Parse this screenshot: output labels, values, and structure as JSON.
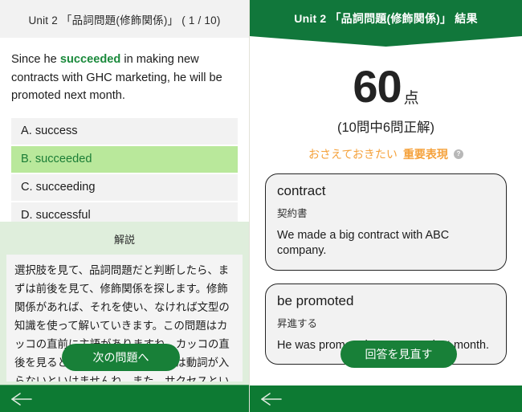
{
  "left_panel": {
    "header_title": "Unit 2 「品詞問題(修飾関係)」 ( 1 / 10)",
    "question_text_before": "Since he ",
    "question_highlight": "succeeded",
    "question_text_after": " in making new contracts with GHC marketing, he will be promoted next month.",
    "choices": [
      {
        "label": "A. success",
        "selected": false
      },
      {
        "label": "B. succeeded",
        "selected": true
      },
      {
        "label": "C. succeeding",
        "selected": false
      },
      {
        "label": "D. successful",
        "selected": false
      }
    ],
    "explanation_title": "解説",
    "explanation_body": "選択肢を見て、品詞問題だと判断したら、まずは前後を見て、修飾関係を探します。修飾関係があれば、それを使い、なければ文型の知識を使って解いていきます。この問題はカッコの直前に主語がありますね。カッコの直後を見ると動詞があり、カッコには動詞が入らないといけませんね。また、サクセスという言葉はカタカナでも使いますが、これは",
    "next_button_label": "次の問題へ",
    "back_icon": "back-arrow-icon"
  },
  "right_panel": {
    "header_title": "Unit 2 「品詞問題(修飾関係)」 結果",
    "score_number": "60",
    "score_unit": "点",
    "score_detail": "(10問中6問正解)",
    "key_expressions_label_1": "おさえておきたい",
    "key_expressions_label_2": "重要表現",
    "help_icon_glyph": "?",
    "cards": [
      {
        "term": "contract",
        "japanese": "契約書",
        "example": "We made a big contract with ABC company."
      },
      {
        "term": "be promoted",
        "japanese": "昇進する",
        "example": "He was promoted to manager last month."
      }
    ],
    "review_button_label": "回答を見直す",
    "back_icon": "back-arrow-icon"
  },
  "colors": {
    "brand_green": "#11773b",
    "button_green": "#188038",
    "bottom_bar_green": "#0d7a33",
    "highlight_green": "#b9e89b",
    "accent_orange": "#f5a23c",
    "panel_gray": "#f2f2f2",
    "explanation_bg": "#dfeedc"
  }
}
